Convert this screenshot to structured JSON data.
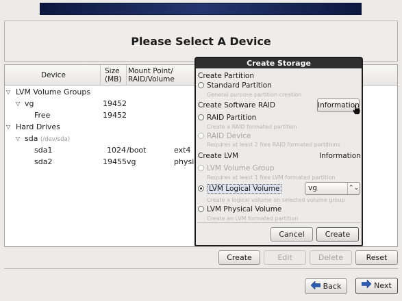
{
  "page": {
    "title": "Please Select A Device"
  },
  "tree": {
    "columns": [
      "Device",
      "Size\n(MB)",
      "Mount Point/\nRAID/Volume"
    ],
    "rows": [
      {
        "device": "LVM Volume Groups",
        "size": "",
        "mount": "",
        "type": "",
        "expander": "▽"
      },
      {
        "device": "vg",
        "size": "19452",
        "mount": "",
        "type": "",
        "expander": "▽"
      },
      {
        "device": "Free",
        "size": "19452",
        "mount": "",
        "type": "",
        "expander": ""
      },
      {
        "device": "Hard Drives",
        "size": "",
        "mount": "",
        "type": "",
        "expander": "▽"
      },
      {
        "device": "sda",
        "device_note": "(/dev/sda)",
        "size": "",
        "mount": "",
        "type": "",
        "expander": "▽"
      },
      {
        "device": "sda1",
        "size": "1024",
        "mount": "/boot",
        "type": "ext4",
        "expander": ""
      },
      {
        "device": "sda2",
        "size": "19455",
        "mount": "vg",
        "type": "physic",
        "expander": ""
      }
    ]
  },
  "actions": {
    "create": "Create",
    "edit": "Edit",
    "delete": "Delete",
    "reset": "Reset"
  },
  "nav": {
    "back": "Back",
    "next": "Next"
  },
  "dialog": {
    "title": "Create Storage",
    "create_partition": "Create Partition",
    "standard_partition": "Standard Partition",
    "standard_partition_desc": "General purpose partition creation",
    "create_software_raid": "Create Software RAID",
    "info_button": "Information",
    "raid_partition": "RAID Partition",
    "raid_partition_desc": "Create a RAID formated partition",
    "raid_device": "RAID Device",
    "raid_device_desc": "Requires at least 2 free RAID formated partitions",
    "create_lvm": "Create LVM",
    "lvm_info": "Information",
    "lvm_volume_group": "LVM Volume Group",
    "lvm_volume_group_desc": "Requires at least 1 free LVM formated partition",
    "lvm_logical_volume": "LVM Logical Volume",
    "lvm_logical_volume_desc": "Create a logical volume on selected volume group",
    "vg_select_value": "vg",
    "lvm_physical_volume": "LVM Physical Volume",
    "lvm_physical_volume_desc": "Create an LVM formated partition",
    "cancel": "Cancel",
    "create": "Create"
  },
  "colors": {
    "banner": "#1a2858",
    "dialog_title_bg": "#2f2f2f",
    "window_bg": "#ecebea"
  }
}
